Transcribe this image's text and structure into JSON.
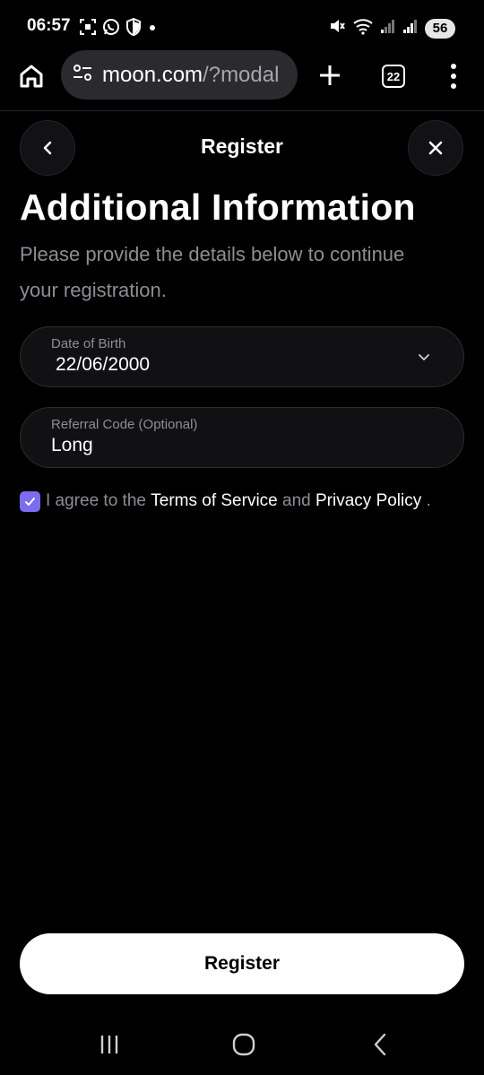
{
  "status_bar": {
    "time": "06:57",
    "battery": "56",
    "left_icons": [
      "screenshot-icon",
      "whatsapp-icon",
      "shield-icon",
      "dot-icon"
    ],
    "right_icons": [
      "mute-icon",
      "wifi-icon",
      "signal-icon",
      "signal-icon"
    ]
  },
  "browser": {
    "url_host": "moon.com",
    "url_path": "/?modal",
    "tab_count": "22"
  },
  "modal": {
    "title": "Register",
    "heading": "Additional Information",
    "subtitle": "Please provide the details below to continue your registration."
  },
  "form": {
    "dob_label": "Date of Birth",
    "dob_value": "22/06/2000",
    "referral_label": "Referral Code (Optional)",
    "referral_value": "Long",
    "agree_checked": true,
    "agree_prefix": "I agree to the",
    "terms_label": "Terms of Service",
    "and_text": "and",
    "privacy_label": "Privacy Policy",
    "period": "."
  },
  "actions": {
    "register_label": "Register"
  },
  "colors": {
    "accent": "#7c6cf0",
    "background": "#000000",
    "field_bg": "#111114",
    "muted_text": "#8d8d96"
  }
}
